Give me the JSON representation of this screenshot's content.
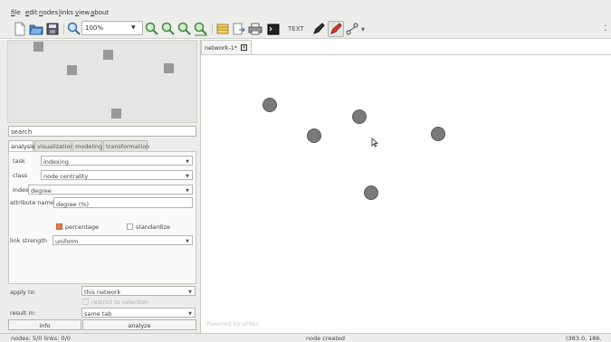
{
  "menu": [
    "file",
    "edit",
    "nodes",
    "links",
    "view",
    "about"
  ],
  "toolbar": {
    "zoom": "100%",
    "text_button": "TEXT"
  },
  "search": {
    "value": "search"
  },
  "tabs": [
    "analysis",
    "visualization",
    "modeling",
    "transformation"
  ],
  "form": {
    "task_label": "task",
    "task_value": "indexing",
    "class_label": "class",
    "class_value": "node centrality",
    "index_label": "index",
    "index_value": "degree",
    "attr_label": "attribute name",
    "attr_value": "degree (%)",
    "percentage_label": "percentage",
    "percentage_checked": true,
    "standardize_label": "standardize",
    "standardize_checked": false,
    "link_strength_label": "link strength",
    "link_strength_value": "uniform"
  },
  "apply": {
    "apply_label": "apply to:",
    "apply_value": "this network",
    "restrict_label": "restrict to selection",
    "result_label": "result in:",
    "result_value": "same tab"
  },
  "buttons": {
    "info": "info",
    "analyze": "analyze"
  },
  "editor": {
    "tab_title": "network-1*",
    "powered": "Powered by yFiles"
  },
  "status": {
    "counts": "nodes: 5/0 links: 0/0",
    "message": "node created",
    "coords": "(383.0, 186."
  },
  "colors": {
    "accent": "#e27b4a",
    "node": "#7a7a7a"
  }
}
